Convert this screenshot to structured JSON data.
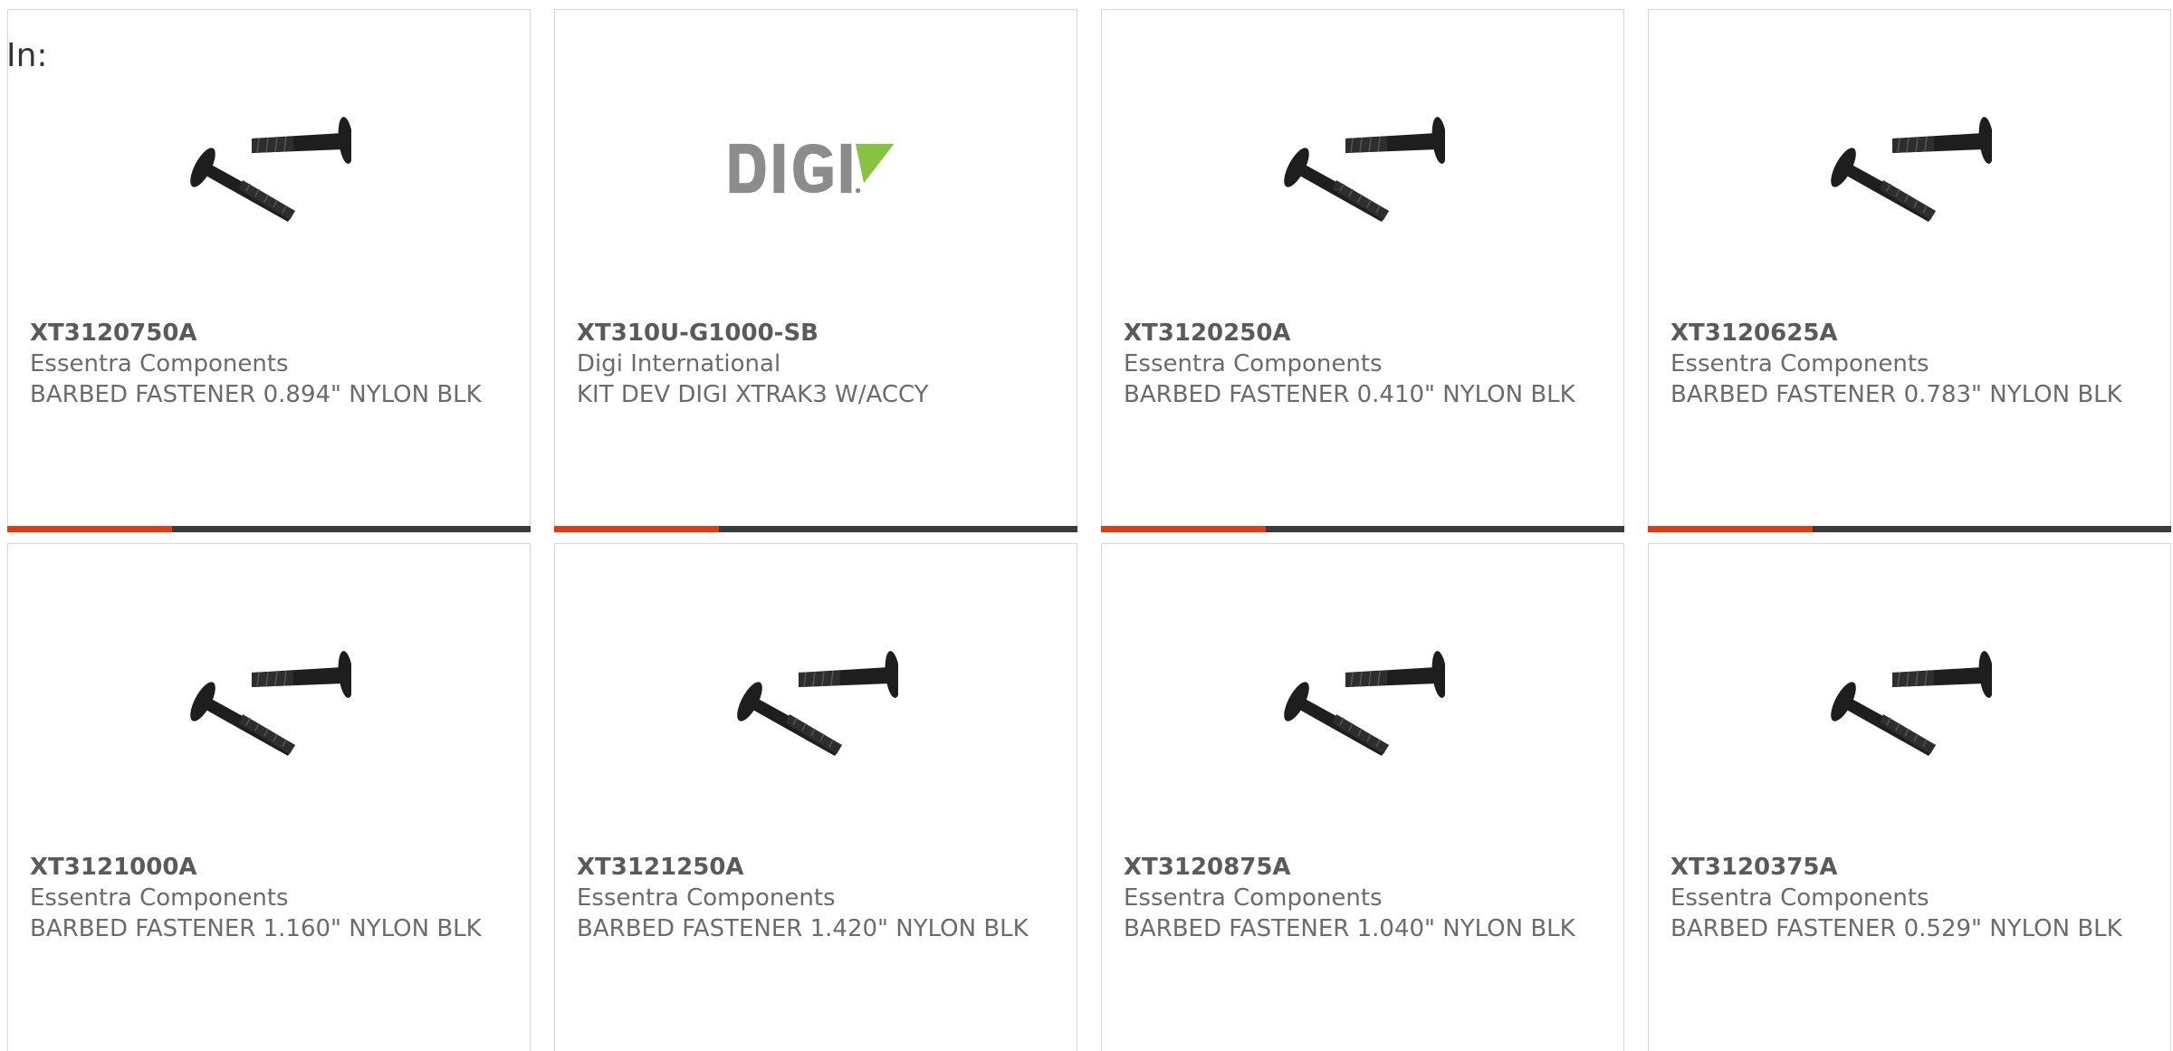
{
  "heading": {
    "label": "In:"
  },
  "colors": {
    "accent": "#e8380d",
    "bar": "#3b3b3b",
    "text_bold": "#5a5a5a",
    "text": "#6b6b6b",
    "digi_green": "#86c440",
    "digi_gray": "#8c8c8c"
  },
  "products": [
    {
      "part_number": "XT3120750A",
      "manufacturer": "Essentra Components",
      "description": "BARBED FASTENER 0.894\" NYLON BLK",
      "image": "barbed-fastener-image"
    },
    {
      "part_number": "XT310U-G1000-SB",
      "manufacturer": "Digi International",
      "description": "KIT DEV DIGI XTRAK3 W/ACCY",
      "image": "digi-logo"
    },
    {
      "part_number": "XT3120250A",
      "manufacturer": "Essentra Components",
      "description": "BARBED FASTENER 0.410\" NYLON BLK",
      "image": "barbed-fastener-image"
    },
    {
      "part_number": "XT3120625A",
      "manufacturer": "Essentra Components",
      "description": "BARBED FASTENER 0.783\" NYLON BLK",
      "image": "barbed-fastener-image"
    },
    {
      "part_number": "XT3121000A",
      "manufacturer": "Essentra Components",
      "description": "BARBED FASTENER 1.160\" NYLON BLK",
      "image": "barbed-fastener-image"
    },
    {
      "part_number": "XT3121250A",
      "manufacturer": "Essentra Components",
      "description": "BARBED FASTENER 1.420\" NYLON BLK",
      "image": "barbed-fastener-image"
    },
    {
      "part_number": "XT3120875A",
      "manufacturer": "Essentra Components",
      "description": "BARBED FASTENER 1.040\" NYLON BLK",
      "image": "barbed-fastener-image"
    },
    {
      "part_number": "XT3120375A",
      "manufacturer": "Essentra Components",
      "description": "BARBED FASTENER 0.529\" NYLON BLK",
      "image": "barbed-fastener-image"
    }
  ]
}
